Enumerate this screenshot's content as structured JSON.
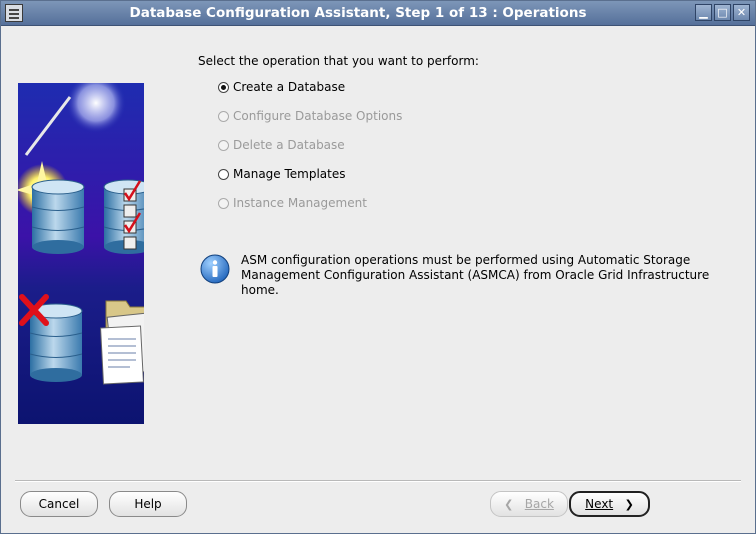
{
  "window": {
    "title": "Database Configuration Assistant, Step 1 of 13 : Operations",
    "controls": {
      "minimize": "▁",
      "maximize": "□",
      "close": "✕"
    }
  },
  "content": {
    "prompt": "Select the operation that you want to perform:",
    "options": [
      {
        "label": "Create a Database",
        "selected": true,
        "enabled": true
      },
      {
        "label": "Configure Database Options",
        "selected": false,
        "enabled": false
      },
      {
        "label": "Delete a Database",
        "selected": false,
        "enabled": false
      },
      {
        "label": "Manage Templates",
        "selected": false,
        "enabled": true
      },
      {
        "label": "Instance Management",
        "selected": false,
        "enabled": false
      }
    ],
    "info": {
      "icon": "info-icon",
      "line1": "ASM configuration operations must be performed using Automatic Storage",
      "line2": "Management Configuration Assistant (ASMCA) from Oracle Grid Infrastructure home."
    }
  },
  "buttons": {
    "cancel": "Cancel",
    "help": "Help",
    "back": "Back",
    "next": "Next"
  },
  "colors": {
    "titlebar": "#55709a",
    "art_background": "#1a1f8c",
    "selected_radio": "#111111",
    "disabled_text": "#9a9a9a"
  }
}
